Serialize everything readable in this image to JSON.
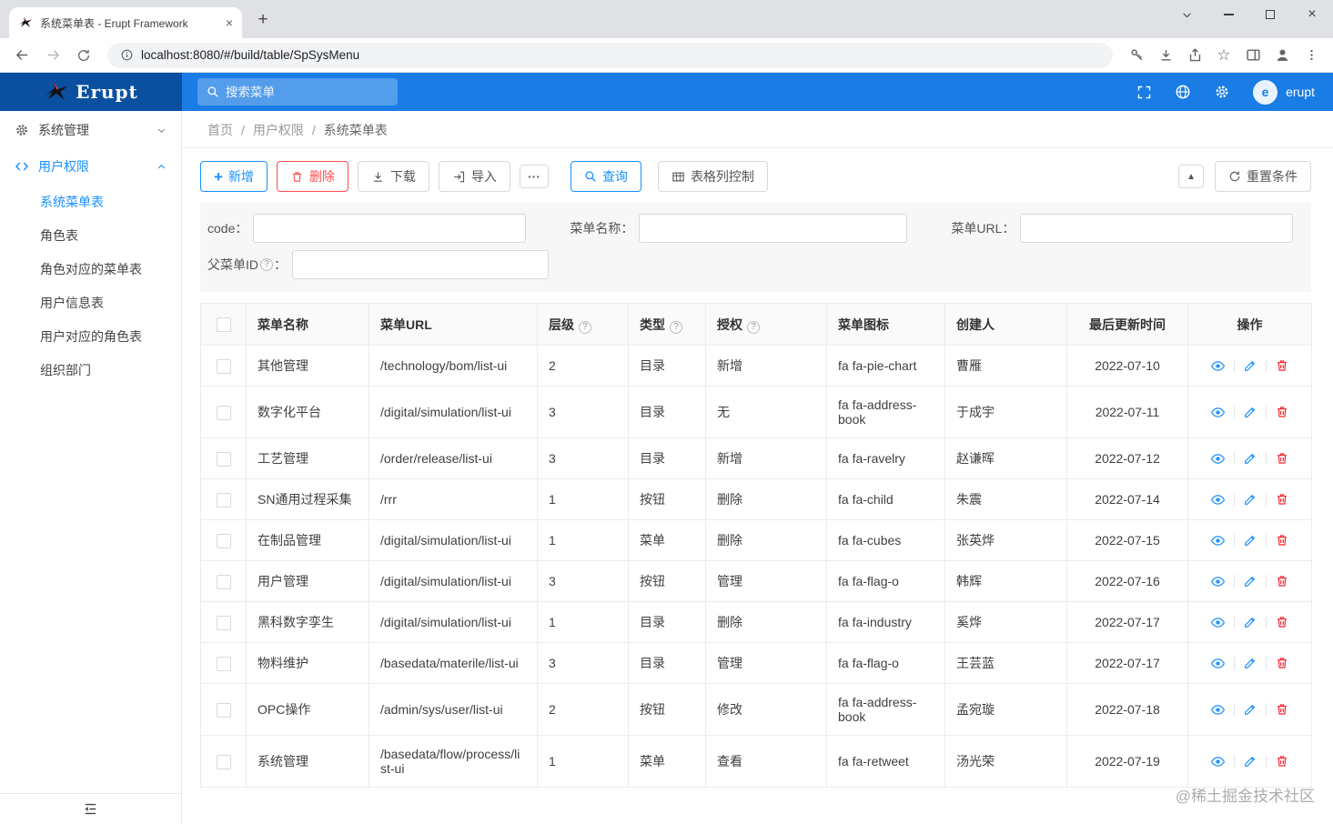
{
  "icons": {
    "plus": "+",
    "close": "×",
    "more": "···",
    "caret_up": "▲",
    "star": "☆",
    "help": "?"
  },
  "browser": {
    "tab": {
      "title": "系统菜单表 - Erupt Framework"
    },
    "address": {
      "url": "localhost:8080/#/build/table/SpSysMenu"
    }
  },
  "app_header": {
    "logo_text": "Erupt",
    "search_placeholder": "搜索菜单",
    "user": {
      "avatar_text": "e",
      "name": "erupt"
    }
  },
  "sidebar": {
    "groups": [
      {
        "label": "系统管理"
      },
      {
        "label": "用户权限"
      }
    ],
    "items": [
      "系统菜单表",
      "角色表",
      "角色对应的菜单表",
      "用户信息表",
      "用户对应的角色表",
      "组织部门"
    ],
    "active_item": "系统菜单表"
  },
  "breadcrumb": {
    "items": [
      "首页",
      "用户权限",
      "系统菜单表"
    ]
  },
  "toolbar": {
    "add": "新增",
    "delete": "删除",
    "download": "下载",
    "import": "导入",
    "query": "查询",
    "table_columns": "表格列控制",
    "reset": "重置条件"
  },
  "filters": {
    "code_label": "code：",
    "menu_name_label": "菜单名称：",
    "menu_url_label": "菜单URL：",
    "parent_id_label": "父菜单ID",
    "colon": "：",
    "code_value": "",
    "menu_name_value": "",
    "menu_url_value": "",
    "parent_id_value": ""
  },
  "table": {
    "headers": [
      {
        "label": "菜单名称",
        "help": false
      },
      {
        "label": "菜单URL",
        "help": false
      },
      {
        "label": "层级",
        "help": true
      },
      {
        "label": "类型",
        "help": true
      },
      {
        "label": "授权",
        "help": true
      },
      {
        "label": "菜单图标",
        "help": false
      },
      {
        "label": "创建人",
        "help": false
      },
      {
        "label": "最后更新时间",
        "help": false
      },
      {
        "label": "操作",
        "help": false
      }
    ],
    "rows": [
      {
        "name": "其他管理",
        "url": "/technology/bom/list-ui",
        "level": "2",
        "type": "目录",
        "auth": "新增",
        "icon": "fa fa-pie-chart",
        "creator": "曹雁",
        "updated": "2022-07-10"
      },
      {
        "name": "数字化平台",
        "url": "/digital/simulation/list-ui",
        "level": "3",
        "type": "目录",
        "auth": "无",
        "icon": "fa fa-address-book",
        "creator": "于成宇",
        "updated": "2022-07-11"
      },
      {
        "name": "工艺管理",
        "url": "/order/release/list-ui",
        "level": "3",
        "type": "目录",
        "auth": "新增",
        "icon": "fa fa-ravelry",
        "creator": "赵谦晖",
        "updated": "2022-07-12"
      },
      {
        "name": "SN通用过程采集",
        "url": "/rrr",
        "level": "1",
        "type": "按钮",
        "auth": "删除",
        "icon": "fa fa-child",
        "creator": "朱震",
        "updated": "2022-07-14"
      },
      {
        "name": "在制品管理",
        "url": "/digital/simulation/list-ui",
        "level": "1",
        "type": "菜单",
        "auth": "删除",
        "icon": "fa fa-cubes",
        "creator": "张英烨",
        "updated": "2022-07-15"
      },
      {
        "name": "用户管理",
        "url": "/digital/simulation/list-ui",
        "level": "3",
        "type": "按钮",
        "auth": "管理",
        "icon": "fa fa-flag-o",
        "creator": "韩辉",
        "updated": "2022-07-16"
      },
      {
        "name": "黑科数字孪生",
        "url": "/digital/simulation/list-ui",
        "level": "1",
        "type": "目录",
        "auth": "删除",
        "icon": "fa fa-industry",
        "creator": "奚烨",
        "updated": "2022-07-17"
      },
      {
        "name": "物料维护",
        "url": "/basedata/materile/list-ui",
        "level": "3",
        "type": "目录",
        "auth": "管理",
        "icon": "fa fa-flag-o",
        "creator": "王芸蓝",
        "updated": "2022-07-17"
      },
      {
        "name": "OPC操作",
        "url": "/admin/sys/user/list-ui",
        "level": "2",
        "type": "按钮",
        "auth": "修改",
        "icon": "fa fa-address-book",
        "creator": "孟宛璇",
        "updated": "2022-07-18"
      },
      {
        "name": "系统管理",
        "url": "/basedata/flow/process/list-ui",
        "level": "1",
        "type": "菜单",
        "auth": "查看",
        "icon": "fa fa-retweet",
        "creator": "汤光荣",
        "updated": "2022-07-19"
      }
    ]
  },
  "watermark": "@稀土掘金技术社区",
  "colors": {
    "accent_blue": "#1890ff",
    "header_blue": "#1a7ce5",
    "logo_blue": "#0b4fa0",
    "danger_red": "#f5222d"
  }
}
